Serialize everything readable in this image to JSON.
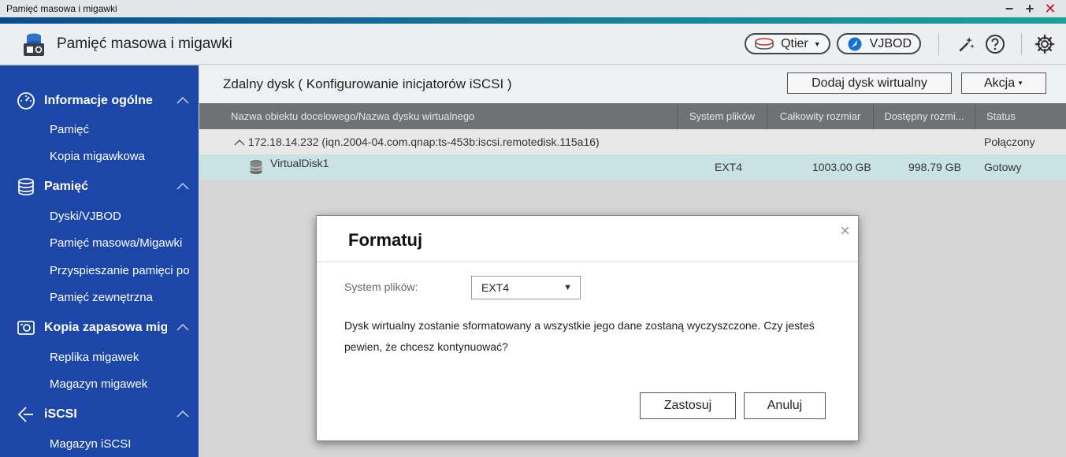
{
  "window": {
    "title": "Pamięć masowa i migawki",
    "controls": {
      "minimize": "−",
      "maximize": "+",
      "close": "✕"
    }
  },
  "header": {
    "app_title": "Pamięć masowa i migawki",
    "qtier_label": "Qtier",
    "vjbod_label": "VJBOD",
    "icons": [
      "storage-app-icon",
      "tools-icon",
      "help-icon",
      "settings-icon"
    ]
  },
  "sidebar": {
    "sections": [
      {
        "label": "Informacje ogólne",
        "icon": "dashboard-icon",
        "items": [
          "Pamięć",
          "Kopia migawkowa"
        ]
      },
      {
        "label": "Pamięć",
        "icon": "database-icon",
        "items": [
          "Dyski/VJBOD",
          "Pamięć masowa/Migawki",
          "Przyspieszanie pamięci po",
          "Pamięć zewnętrzna"
        ]
      },
      {
        "label": "Kopia zapasowa miga",
        "icon": "snapshot-backup-icon",
        "items": [
          "Replika migawek",
          "Magazyn migawek"
        ]
      },
      {
        "label": "iSCSI",
        "icon": "iscsi-icon",
        "items": [
          "Magazyn iSCSI"
        ]
      }
    ]
  },
  "main": {
    "title": "Zdalny dysk ( Konfigurowanie inicjatorów iSCSI )",
    "add_button": "Dodaj dysk wirtualny",
    "action_button": "Akcja",
    "columns": [
      "Nazwa obiektu docelowego/Nazwa dysku wirtualnego",
      "System plików",
      "Całkowity rozmiar",
      "Dostępny rozmi...",
      "Status"
    ],
    "target_row": {
      "name": "172.18.14.232 (iqn.2004-04.com.qnap:ts-453b:iscsi.remotedisk.115a16)",
      "status": "Połączony"
    },
    "disk_row": {
      "name": "VirtualDisk1",
      "filesystem": "EXT4",
      "total": "1003.00 GB",
      "available": "998.79 GB",
      "status": "Gotowy"
    }
  },
  "dialog": {
    "title": "Formatuj",
    "close": "×",
    "fs_label": "System plików:",
    "fs_value": "EXT4",
    "message": "Dysk wirtualny zostanie sformatowany a wszystkie jego dane zostaną wyczyszczone. Czy jesteś pewien, że chcesz kontynuować?",
    "apply_label": "Zastosuj",
    "cancel_label": "Anuluj"
  },
  "colors": {
    "sidebar": "#1c46a8",
    "accent": "#177a9b",
    "selected_row": "#c9e3e4",
    "table_header": "#6f7174"
  }
}
